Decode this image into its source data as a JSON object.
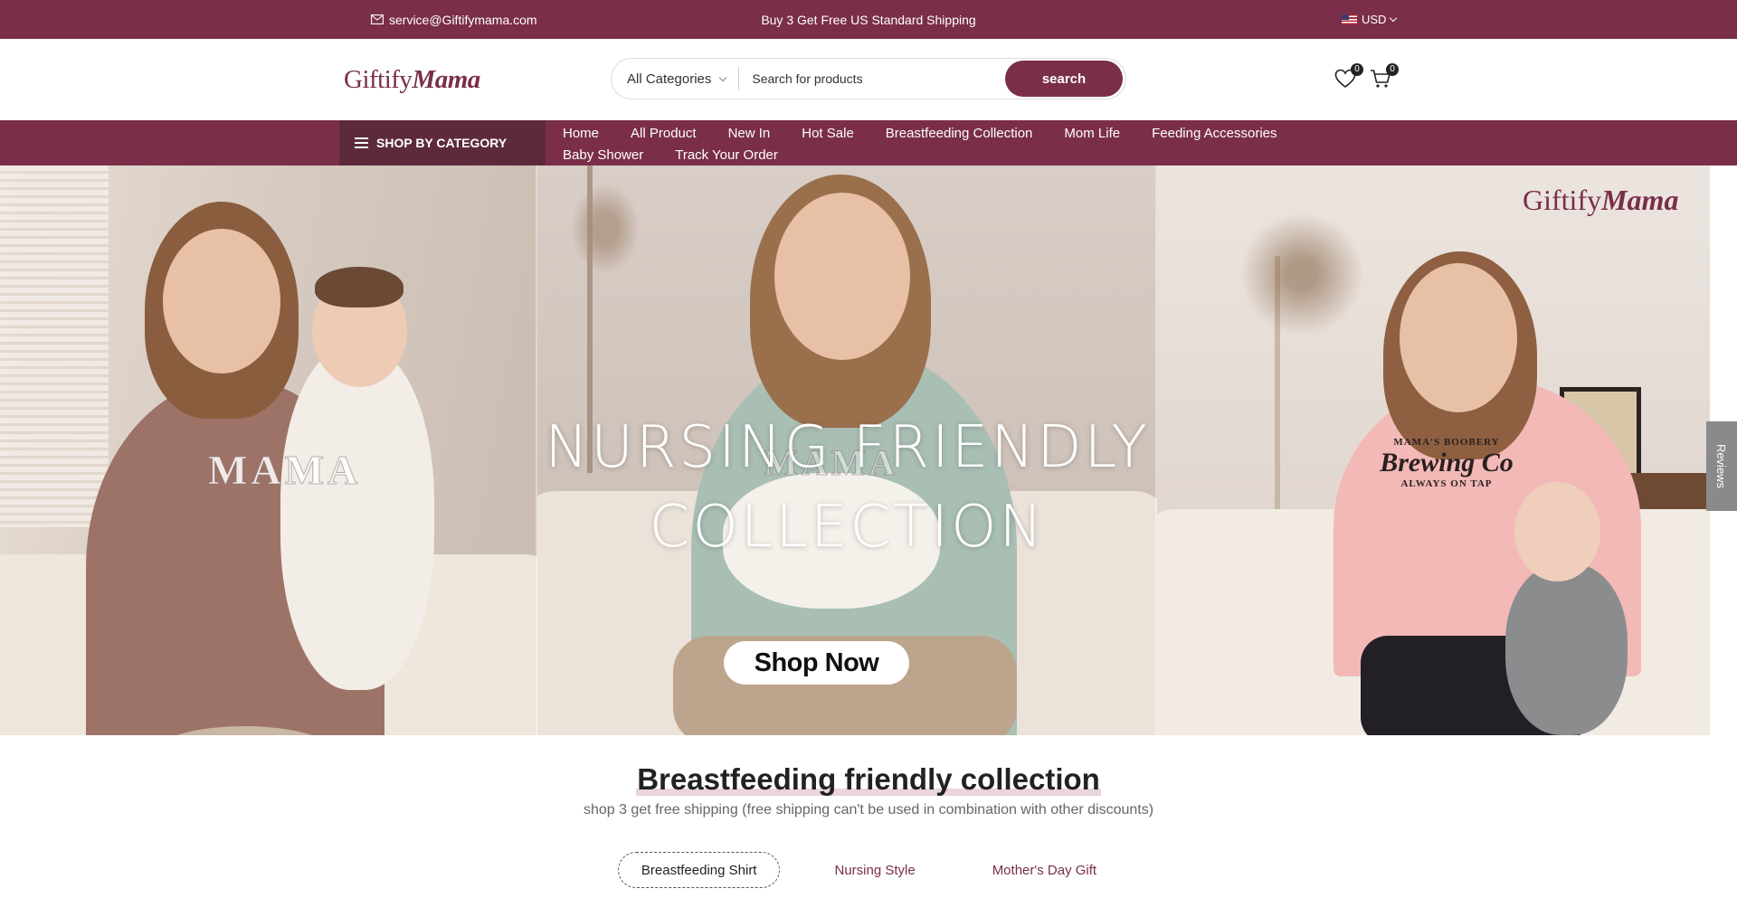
{
  "topbar": {
    "email": "service@Giftifymama.com",
    "promo": "Buy 3 Get Free US Standard Shipping",
    "currency": "USD"
  },
  "header": {
    "logo_part1": "Giftify",
    "logo_part2": "Mama",
    "category_select": "All Categories",
    "search_placeholder": "Search for products",
    "search_button": "search",
    "wishlist_count": "0",
    "cart_count": "0"
  },
  "nav": {
    "shop_by_category": "SHOP BY CATEGORY",
    "links": [
      "Home",
      "All Product",
      "New In",
      "Hot Sale",
      "Breastfeeding Collection",
      "Mom Life",
      "Feeding Accessories",
      "Baby Shower",
      "Track Your Order"
    ]
  },
  "hero": {
    "title_line1": "NURSING FRIENDLY",
    "title_line2": "COLLECTION",
    "cta": "Shop Now",
    "logo_part1": "Giftify",
    "logo_part2": "Mama",
    "shirt_print_left": "MAMA",
    "shirt_print_center": "MAMA",
    "shirt_print_right_top": "MAMA'S BOOBERY",
    "shirt_print_right_main": "Brewing Co",
    "shirt_print_right_bottom": "ALWAYS ON TAP"
  },
  "reviews_tab": "Reviews",
  "section": {
    "title": "Breastfeeding friendly collection",
    "subtitle": "shop 3 get free shipping (free shipping can't be used in combination with other discounts)",
    "tabs": [
      "Breastfeeding Shirt",
      "Nursing Style",
      "Mother's Day Gift"
    ],
    "active_tab": "Breastfeeding Shirt"
  },
  "colors": {
    "brand": "#7a2e4a",
    "brand_dark": "#5d2a3d"
  },
  "icons": [
    "mail-icon",
    "flag-us-icon",
    "chevron-down-icon",
    "heart-icon",
    "cart-icon",
    "menu-icon"
  ]
}
